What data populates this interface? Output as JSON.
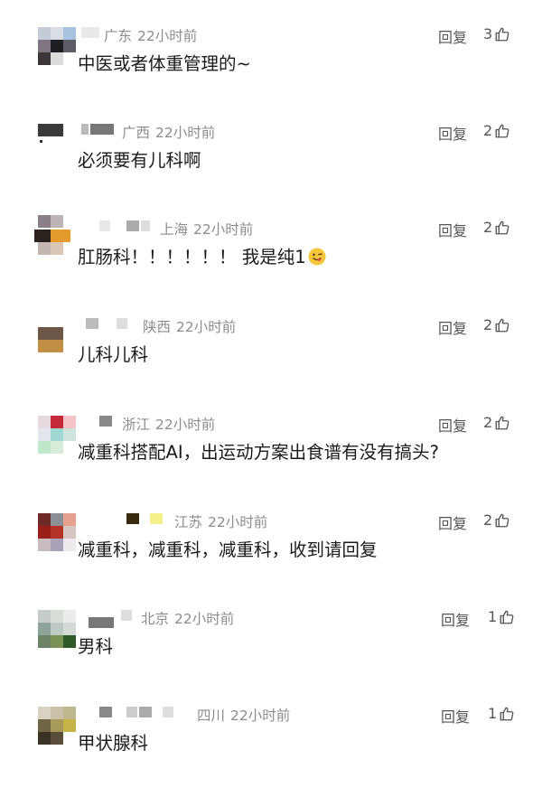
{
  "ui": {
    "reply_label": "回复"
  },
  "comments": [
    {
      "location": "广东",
      "time": "22小时前",
      "likes": "3",
      "text": "中医或者体重管理的~"
    },
    {
      "location": "广西",
      "time": "22小时前",
      "likes": "2",
      "text": "必须要有儿科啊"
    },
    {
      "location": "上海",
      "time": "22小时前",
      "likes": "2",
      "text": "肛肠科！！！！！！ 我是纯1",
      "emoji": "winking-face-tongue-emoji"
    },
    {
      "location": "陕西",
      "time": "22小时前",
      "likes": "2",
      "text": "儿科儿科"
    },
    {
      "location": "浙江",
      "time": "22小时前",
      "likes": "2",
      "text": "减重科搭配AI，出运动方案出食谱有没有搞头?"
    },
    {
      "location": "江苏",
      "time": "22小时前",
      "likes": "2",
      "text": "减重科，减重科，减重科，收到请回复"
    },
    {
      "location": "北京",
      "time": "22小时前",
      "likes": "1",
      "text": "男科"
    },
    {
      "location": "四川",
      "time": "22小时前",
      "likes": "1",
      "text": "甲状腺科"
    }
  ],
  "colors": {
    "text": "#1a1a1a",
    "meta": "#8c8c8c",
    "action": "#555555"
  }
}
